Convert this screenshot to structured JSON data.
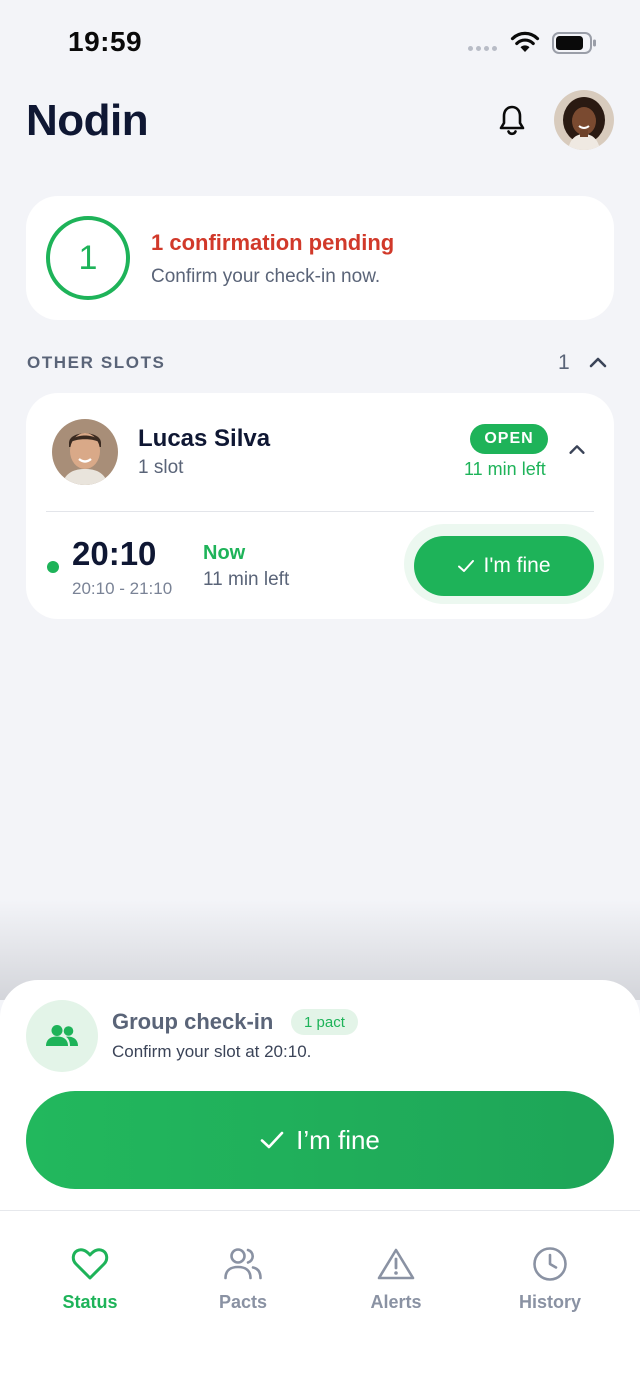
{
  "status_bar": {
    "time": "19:59"
  },
  "header": {
    "title": "Nodin"
  },
  "pending": {
    "count": "1",
    "title": "1 confirmation pending",
    "subtitle": "Confirm your check-in now."
  },
  "other_slots": {
    "label": "OTHER SLOTS",
    "count": "1",
    "person": {
      "name": "Lucas Silva",
      "slots": "1 slot",
      "badge": "OPEN",
      "time_left": "11 min left"
    },
    "slot": {
      "time": "20:10",
      "range": "20:10 - 21:10",
      "status": "Now",
      "time_left": "11 min left",
      "button_label": "I'm fine"
    }
  },
  "sheet": {
    "title": "Group check-in",
    "badge": "1 pact",
    "subtitle": "Confirm your slot at 20:10.",
    "button_label": "I’m fine"
  },
  "nav": {
    "items": [
      {
        "label": "Status",
        "icon": "heart-icon",
        "active": true
      },
      {
        "label": "Pacts",
        "icon": "users-icon",
        "active": false
      },
      {
        "label": "Alerts",
        "icon": "warning-icon",
        "active": false
      },
      {
        "label": "History",
        "icon": "clock-icon",
        "active": false
      }
    ]
  },
  "colors": {
    "accent": "#1eb359",
    "alert": "#d1392a",
    "background": "#f3f4f8",
    "text": "#0f1733",
    "muted": "#5a6478"
  }
}
